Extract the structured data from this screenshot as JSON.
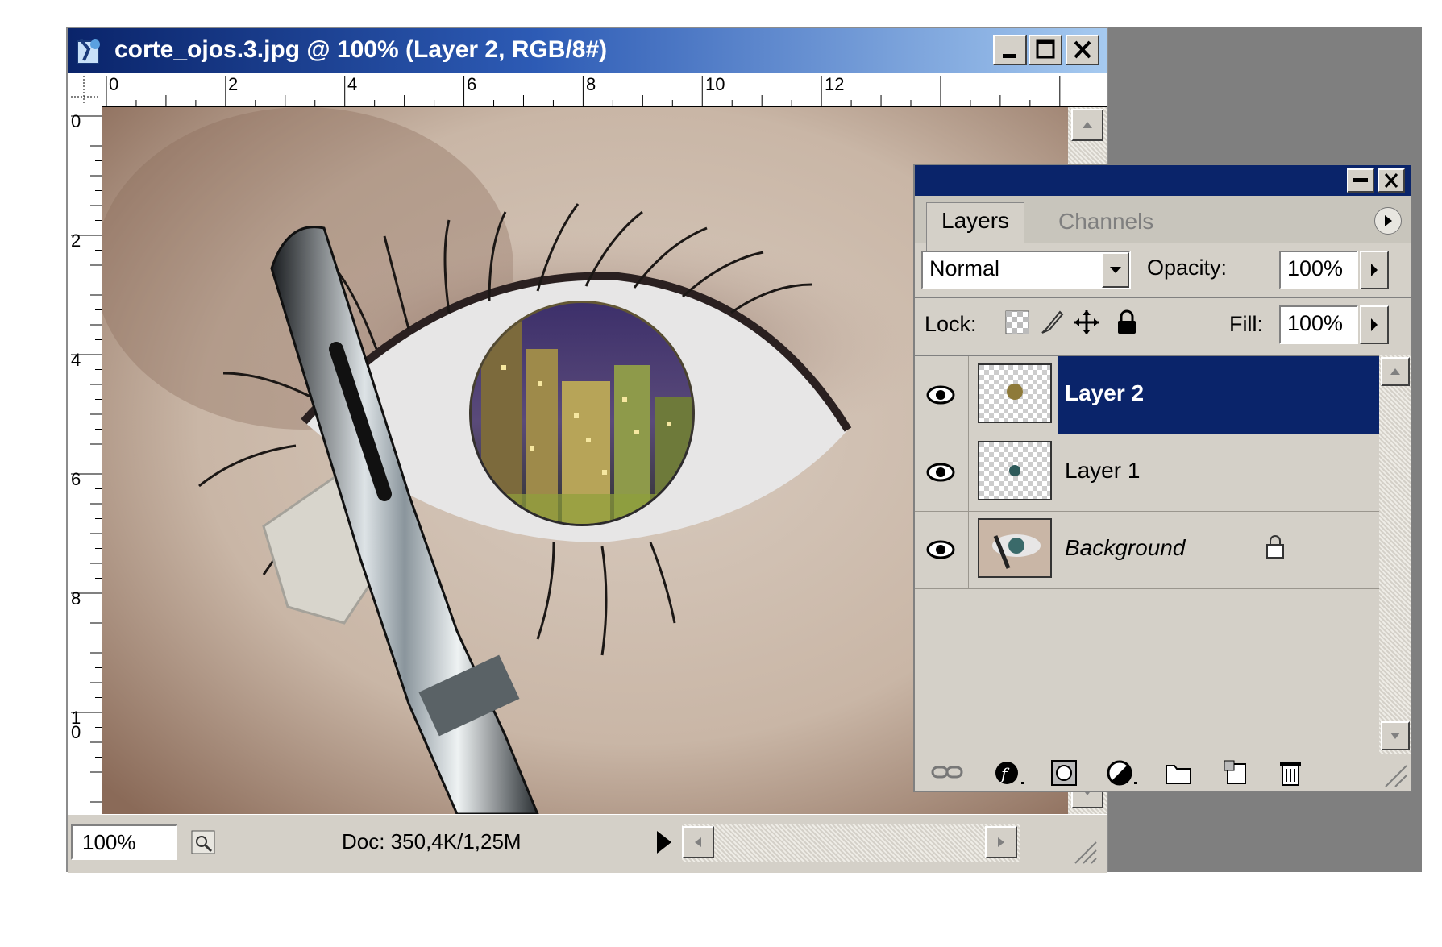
{
  "document": {
    "title": "corte_ojos.3.jpg @ 100% (Layer 2, RGB/8#)",
    "ruler_h_labels": [
      "0",
      "2",
      "4",
      "6",
      "8",
      "10",
      "12"
    ],
    "ruler_v_labels": [
      "0",
      "2",
      "4",
      "6",
      "8",
      "1\n0"
    ],
    "zoom": "100%",
    "status_text": "Doc: 350,4K/1,25M"
  },
  "layers_palette": {
    "tabs": [
      "Layers",
      "Channels"
    ],
    "active_tab": "Layers",
    "blend_mode": "Normal",
    "opacity_label": "Opacity:",
    "opacity_value": "100%",
    "lock_label": "Lock:",
    "fill_label": "Fill:",
    "fill_value": "100%",
    "layers": [
      {
        "name": "Layer 2",
        "visible": true,
        "selected": true
      },
      {
        "name": "Layer 1",
        "visible": true,
        "selected": false
      },
      {
        "name": "Background",
        "visible": true,
        "selected": false,
        "locked": true
      }
    ]
  },
  "colors": {
    "title_bar": "#0a246a",
    "selection": "#0a246a",
    "panel": "#d4d0c8"
  }
}
